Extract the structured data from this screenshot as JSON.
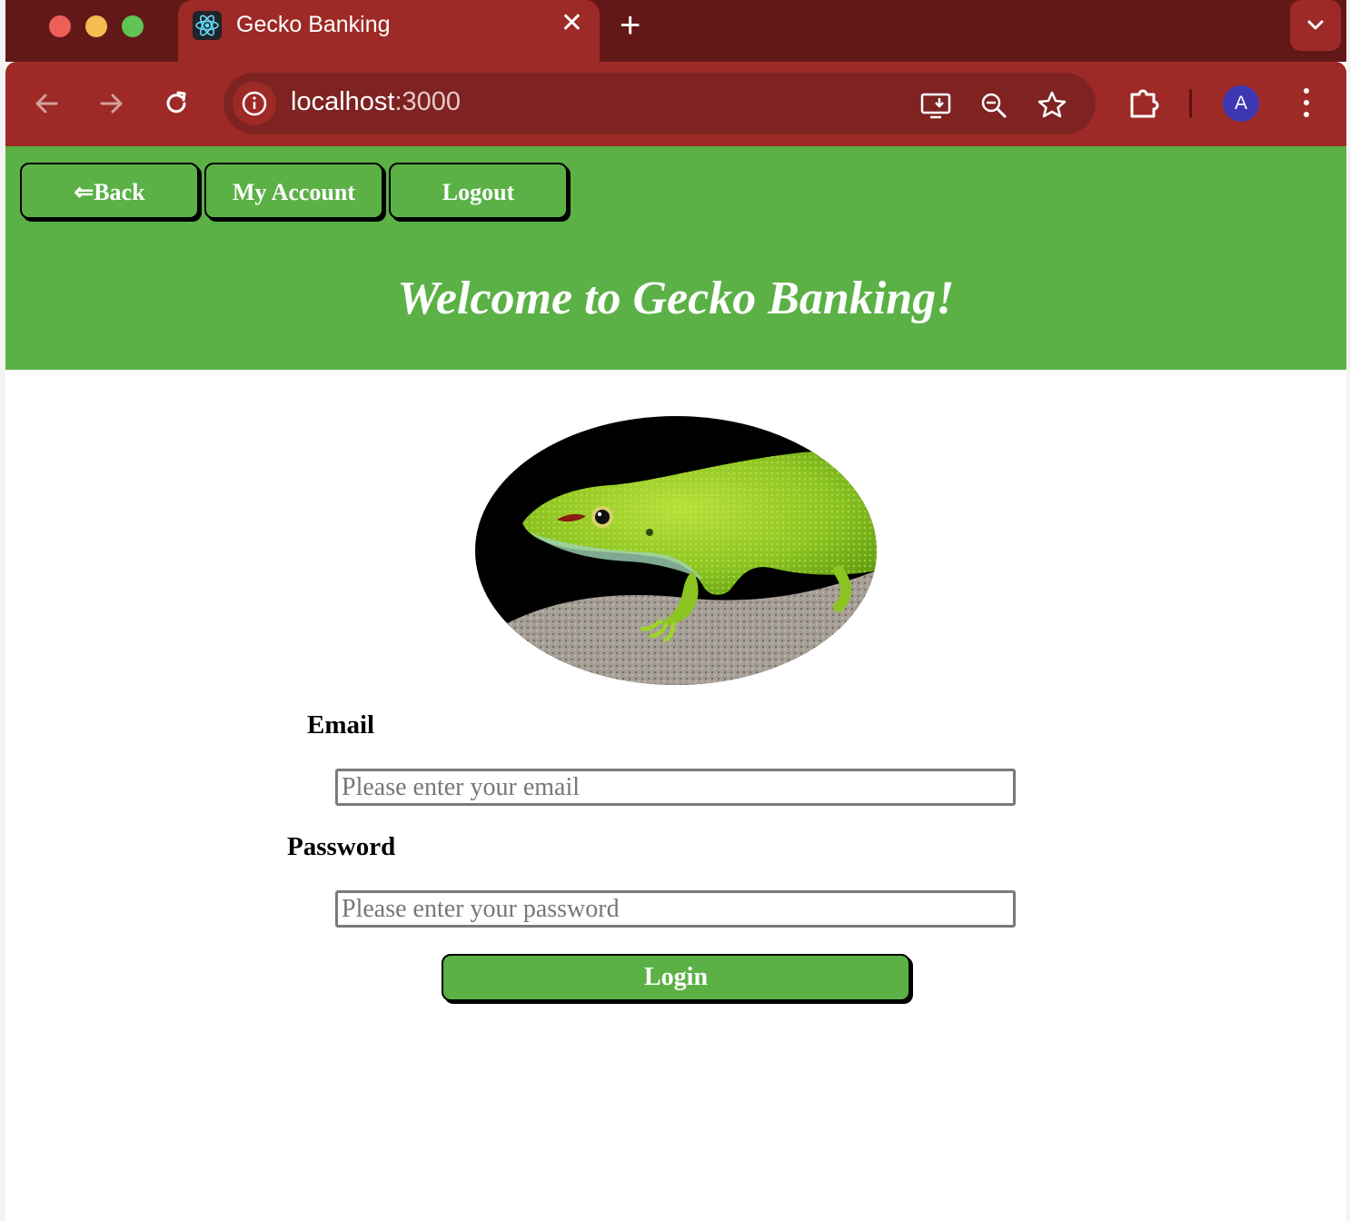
{
  "browser": {
    "tab_title": "Gecko Banking",
    "new_tab_symbol": "+",
    "close_symbol": "✕",
    "url_host": "localhost",
    "url_port": ":3000",
    "profile_initial": "A"
  },
  "header": {
    "back_label": "⇐Back",
    "account_label": "My Account",
    "logout_label": "Logout",
    "welcome": "Welcome to Gecko Banking!"
  },
  "form": {
    "email_label": "Email",
    "email_placeholder": "Please enter your email",
    "password_label": "Password",
    "password_placeholder": "Please enter your password",
    "login_label": "Login"
  },
  "colors": {
    "brand_green": "#5bb146",
    "browser_red": "#9d2a26"
  }
}
